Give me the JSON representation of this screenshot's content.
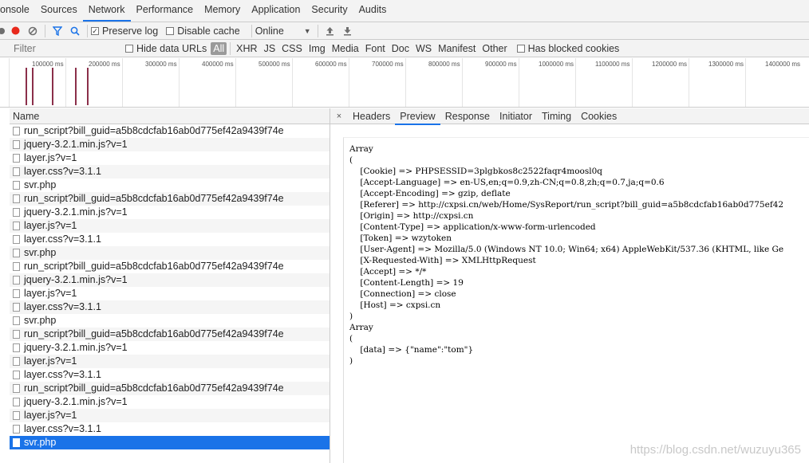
{
  "main_tabs": [
    {
      "label": "onsole"
    },
    {
      "label": "Sources"
    },
    {
      "label": "Network"
    },
    {
      "label": "Performance"
    },
    {
      "label": "Memory"
    },
    {
      "label": "Application"
    },
    {
      "label": "Security"
    },
    {
      "label": "Audits"
    }
  ],
  "toolbar": {
    "preserve_log": "Preserve log",
    "disable_cache": "Disable cache",
    "throttling": "Online"
  },
  "filterbar": {
    "filter_placeholder": "Filter",
    "hide_data_urls": "Hide data URLs",
    "types": [
      "All",
      "XHR",
      "JS",
      "CSS",
      "Img",
      "Media",
      "Font",
      "Doc",
      "WS",
      "Manifest",
      "Other"
    ],
    "has_blocked_cookies": "Has blocked cookies"
  },
  "overview": {
    "ticks": [
      "100000 ms",
      "200000 ms",
      "300000 ms",
      "400000 ms",
      "500000 ms",
      "600000 ms",
      "700000 ms",
      "800000 ms",
      "900000 ms",
      "1000000 ms",
      "1100000 ms",
      "1200000 ms",
      "1300000 ms",
      "1400000 ms"
    ]
  },
  "list": {
    "header": "Name",
    "rows": [
      "run_script?bill_guid=a5b8cdcfab16ab0d775ef42a9439f74e",
      "jquery-3.2.1.min.js?v=1",
      "layer.js?v=1",
      "layer.css?v=3.1.1",
      "svr.php",
      "run_script?bill_guid=a5b8cdcfab16ab0d775ef42a9439f74e",
      "jquery-3.2.1.min.js?v=1",
      "layer.js?v=1",
      "layer.css?v=3.1.1",
      "svr.php",
      "run_script?bill_guid=a5b8cdcfab16ab0d775ef42a9439f74e",
      "jquery-3.2.1.min.js?v=1",
      "layer.js?v=1",
      "layer.css?v=3.1.1",
      "svr.php",
      "run_script?bill_guid=a5b8cdcfab16ab0d775ef42a9439f74e",
      "jquery-3.2.1.min.js?v=1",
      "layer.js?v=1",
      "layer.css?v=3.1.1",
      "run_script?bill_guid=a5b8cdcfab16ab0d775ef42a9439f74e",
      "jquery-3.2.1.min.js?v=1",
      "layer.js?v=1",
      "layer.css?v=3.1.1",
      "svr.php"
    ],
    "selected_index": 23
  },
  "detail": {
    "close": "×",
    "tabs": [
      "Headers",
      "Preview",
      "Response",
      "Initiator",
      "Timing",
      "Cookies"
    ],
    "selected_tab": 1,
    "preview_lines": [
      "Array",
      "(",
      "    [Cookie] => PHPSESSID=3plgbkos8c2522faqr4moosl0q",
      "    [Accept-Language] => en-US,en;q=0.9,zh-CN;q=0.8,zh;q=0.7,ja;q=0.6",
      "    [Accept-Encoding] => gzip, deflate",
      "    [Referer] => http://cxpsi.cn/web/Home/SysReport/run_script?bill_guid=a5b8cdcfab16ab0d775ef42",
      "    [Origin] => http://cxpsi.cn",
      "    [Content-Type] => application/x-www-form-urlencoded",
      "    [Token] => wzytoken",
      "    [User-Agent] => Mozilla/5.0 (Windows NT 10.0; Win64; x64) AppleWebKit/537.36 (KHTML, like Ge",
      "    [X-Requested-With] => XMLHttpRequest",
      "    [Accept] => */*",
      "    [Content-Length] => 19",
      "    [Connection] => close",
      "    [Host] => cxpsi.cn",
      ")",
      "Array",
      "(",
      "    [data] => {\"name\":\"tom\"}",
      ")"
    ]
  },
  "watermark": "https://blog.csdn.net/wuzuyu365"
}
